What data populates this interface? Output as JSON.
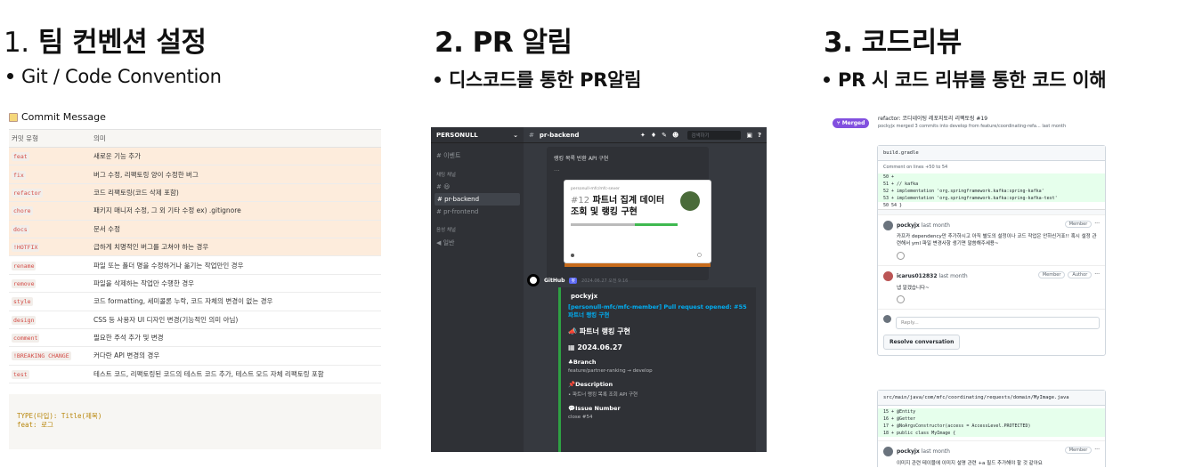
{
  "sections": [
    {
      "num": "1.",
      "title": "팀 컨벤션 설정",
      "sub": "Git / Code Convention"
    },
    {
      "num": "2.",
      "title": "PR 알림",
      "sub": "디스코드를 통한 PR알림"
    },
    {
      "num": "3.",
      "title": "코드리뷰",
      "sub": "PR 시 코드 리뷰를 통한 코드 이해"
    }
  ],
  "convention": {
    "heading": "Commit Message",
    "col_type": "커밋 유형",
    "col_desc": "의미",
    "rows": [
      {
        "type": "feat",
        "desc": "새로운 기능 추가",
        "hl": true
      },
      {
        "type": "fix",
        "desc": "버그 수정, 리팩토링 양이 수정한 버그",
        "hl": true
      },
      {
        "type": "refactor",
        "desc": "코드 리팩토링(코드 삭제 포함)",
        "hl": true
      },
      {
        "type": "chore",
        "desc": "패키지 매니저 수정, 그 외 기타 수정 ex) .gitignore",
        "hl": true
      },
      {
        "type": "docs",
        "desc": "문서 수정",
        "hl": true
      },
      {
        "type": "!HOTFIX",
        "desc": "급하게 치명적인 버그를 고쳐야 하는 경우",
        "hl": true
      },
      {
        "type": "rename",
        "desc": "파일 또는 폴더 명을 수정하거나 옮기는 작업만인 경우",
        "hl": false
      },
      {
        "type": "remove",
        "desc": "파일을 삭제하는 작업만 수행한 경우",
        "hl": false
      },
      {
        "type": "style",
        "desc": "코드 formatting, 세미콜론 누락, 코드 자체의 변경이 없는 경우",
        "hl": false
      },
      {
        "type": "design",
        "desc": "CSS 등 사용자 UI 디자인 변경(기능적인 의미 아님)",
        "hl": false
      },
      {
        "type": "comment",
        "desc": "필요한 주석 추가 및 변경",
        "hl": false
      },
      {
        "type": "!BREAKING CHANGE",
        "desc": "커다란 API 변경의 경우",
        "hl": false
      },
      {
        "type": "test",
        "desc": "테스트 코드, 리팩토링된 코드의 테스트 코드 추가, 테스트 모드 자체 리팩토링 포함",
        "hl": false
      }
    ],
    "code_line1": "TYPE(타입): Title(제목)",
    "code_line2": "feat: 로그"
  },
  "discord": {
    "server": "PERSONULL",
    "channel_top": "# 이벤트",
    "cat_text": "채팅 채널",
    "channels": [
      "# 😃",
      "# pr-backend",
      "# pr-frontend"
    ],
    "cat_voice": "음성 채널",
    "voice": "◀ 일반",
    "header_channel": "pr-backend",
    "search": "검색하기",
    "embed_title": "랭킹 목록 반환 API 구현",
    "card_repo": "personull-mfc/mfc-sever",
    "card_num": "#12",
    "card_title": "파트너 집계 데이터 조회 및 랭킹 구현",
    "author": "GitHub",
    "bot": "봇",
    "time": "2024.06.27 오전 9:16",
    "user": "pockyjx",
    "link": "[personull-mfc/mfc-member] Pull request opened: #55 파트너 랭킹 구현",
    "f1": "파트너 랭킹 구현",
    "f2": "2024.06.27",
    "f3": "Branch",
    "f3v": "feature/partner-ranking → develop",
    "f4": "Description",
    "f4v": "• 파트너 랭킹 목록 조회 API 구현",
    "f5": "Issue Number",
    "f5v": "close #54"
  },
  "github": {
    "status": "Merged",
    "pr_title": "refactor: 코디네이팅 레포지토리 리팩토링 #19",
    "pr_meta": "pockyjx merged 3 commits into develop from feature/coordinating-refa... last month",
    "file1": "build.gradle",
    "comment_on": "Comment on lines +50 to 54",
    "diff1": [
      "50  +",
      "51  +      // kafka",
      "52  +      implementation 'org.springframework.kafka:spring-kafka'",
      "53  +      implementation 'org.springframework.kafka:spring-kafka-test'",
      "50   54    }"
    ],
    "c1_user": "pockyjx",
    "c1_time": "last month",
    "c1_badge": "Member",
    "c1_text": "카프카 dependency만 추가하시고 아직 별도의 설정이나 코드 작업은 안하신거죠!! 혹시 설정 관련해서 yml 파일 변경사항 생기면 말씀해주세용~",
    "c2_user": "icarus012832",
    "c2_time": "last month",
    "c2_badge1": "Member",
    "c2_badge2": "Author",
    "c2_text": "넵 알겠습니다~",
    "reply": "Reply...",
    "resolve": "Resolve conversation",
    "file2": "src/main/java/com/mfc/coordinating/requests/domain/MyImage.java",
    "diff2": [
      "15  + @Entity",
      "16  + @Getter",
      "17  + @NoArgsConstructor(access = AccessLevel.PROTECTED)",
      "18  + public class MyImage {"
    ],
    "c3_user": "pockyjx",
    "c3_time": "last month",
    "c3_badge": "Member",
    "c3_text": "이미지 관련 테이블에 이미지 설명 관련 +a 필드 추가해야 할 것 같아요"
  }
}
